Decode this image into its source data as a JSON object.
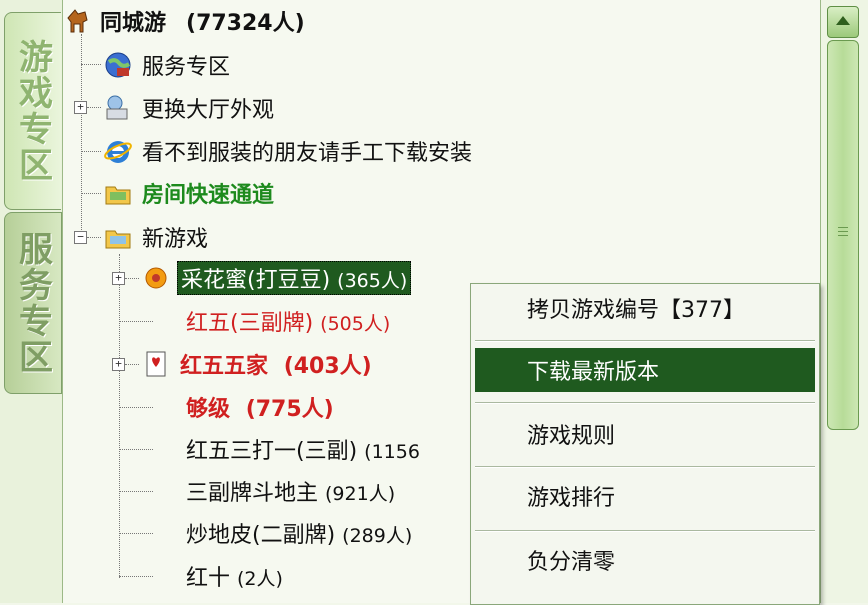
{
  "tabs": [
    {
      "label": "游戏专区",
      "active": true
    },
    {
      "label": "服务专区",
      "active": false
    }
  ],
  "root": {
    "name": "同城游",
    "count": "(77324人)"
  },
  "tree": [
    {
      "label": "服务专区"
    },
    {
      "label": "更换大厅外观"
    },
    {
      "label": "看不到服装的朋友请手工下载安装"
    },
    {
      "label": "房间快速通道"
    },
    {
      "label": "新游戏"
    }
  ],
  "games": [
    {
      "name": "采花蜜(打豆豆)",
      "count": "(365人)"
    },
    {
      "name": "红五(三副牌)",
      "count": "(505人)"
    },
    {
      "name": "红五五家",
      "count": "(403人)"
    },
    {
      "name": "够级",
      "count": "(775人)"
    },
    {
      "name": "红五三打一(三副)",
      "count": "(1156"
    },
    {
      "name": "三副牌斗地主",
      "count": "(921人)"
    },
    {
      "name": "炒地皮(二副牌)",
      "count": "(289人)"
    },
    {
      "name": "红十",
      "count": "(2人)"
    }
  ],
  "context_menu": [
    {
      "label": "拷贝游戏编号【377】"
    },
    {
      "label": "下载最新版本",
      "highlighted": true
    },
    {
      "label": "游戏规则"
    },
    {
      "label": "游戏排行"
    },
    {
      "label": "负分清零"
    }
  ],
  "colors": {
    "selection": "#1f5a1f",
    "green_text": "#1d8a1d",
    "red_text": "#d02020"
  }
}
